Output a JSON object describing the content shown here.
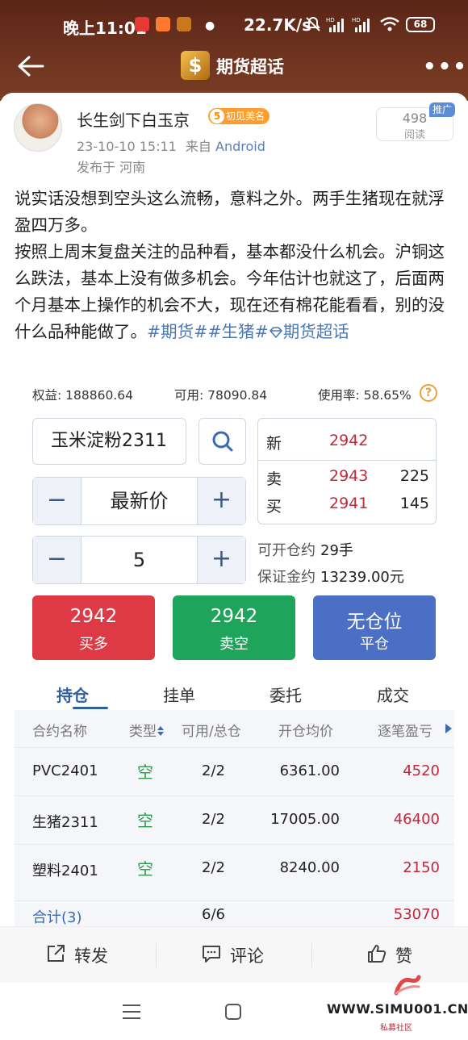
{
  "status_bar": {
    "time": "晚上11:01",
    "net_speed": "22.7K/s",
    "battery": "68"
  },
  "topbar": {
    "title": "期货超话",
    "logo_glyph": "$",
    "back_icon": "arrow-left-icon",
    "more_icon": "more-dots-icon",
    "more_glyph": "•••"
  },
  "post": {
    "author": "长生剑下白玉京",
    "level": "5",
    "level_label": "初见美名",
    "date": "23-10-10 15:11",
    "source_prefix": "来自",
    "source": "Android",
    "location": "发布于 河南",
    "reads": "498",
    "reads_label": "阅读",
    "promo_tag": "推广",
    "body_line1": "说实话没想到空头这么流畅，意料之外。两手生猪现在就浮盈四万多。",
    "body_line2": "按照上周末复盘关注的品种看，基本都没什么机会。沪铜这么跌法，基本上没有做多机会。今年估计也就这了，后面两个月基本上操作的机会不大，现在还有棉花能看看，别的没什么品种能做了。",
    "tags": "#期货##生猪#",
    "super_topic": "期货超话"
  },
  "account": {
    "equity": "权益: 188860.64",
    "available": "可用: 78090.84",
    "usage": "使用率: 58.65%",
    "help_glyph": "?"
  },
  "order": {
    "symbol": "玉米淀粉2311",
    "price_mode": "最新价",
    "quantity": "5",
    "minus": "−",
    "plus": "+"
  },
  "quote": {
    "last_label": "新",
    "last_price": "2942",
    "ask_label": "卖",
    "ask_price": "2943",
    "ask_vol": "225",
    "bid_label": "买",
    "bid_price": "2941",
    "bid_vol": "145"
  },
  "capacity": {
    "open_label": "可开仓约",
    "open_value": "29手",
    "margin_label": "保证金约",
    "margin_value": "13239.00元"
  },
  "buttons": {
    "buy_price": "2942",
    "buy_label": "买多",
    "sell_price": "2942",
    "sell_label": "卖空",
    "close_title": "无仓位",
    "close_label": "平仓"
  },
  "colors": {
    "buy": "#dd3a46",
    "sell": "#1fa55b",
    "close": "#4a6fc4"
  },
  "tabs": [
    "持仓",
    "挂单",
    "委托",
    "成交"
  ],
  "positions": {
    "headers": [
      "合约名称",
      "类型",
      "可用/总仓",
      "开仓均价",
      "逐笔盈亏"
    ],
    "rows": [
      {
        "contract": "PVC2401",
        "type": "空",
        "qty": "2/2",
        "avg": "6361.00",
        "pnl": "4520"
      },
      {
        "contract": "生猪2311",
        "type": "空",
        "qty": "2/2",
        "avg": "17005.00",
        "pnl": "46400"
      },
      {
        "contract": "塑料2401",
        "type": "空",
        "qty": "2/2",
        "avg": "8240.00",
        "pnl": "2150"
      }
    ],
    "total_label": "合计(3)",
    "total_qty": "6/6",
    "total_pnl": "53070"
  },
  "actions": {
    "share": "转发",
    "comment": "评论",
    "like": "赞"
  },
  "watermark": {
    "text": "WWW.SIMU001.CN",
    "sub": "私募社区"
  }
}
